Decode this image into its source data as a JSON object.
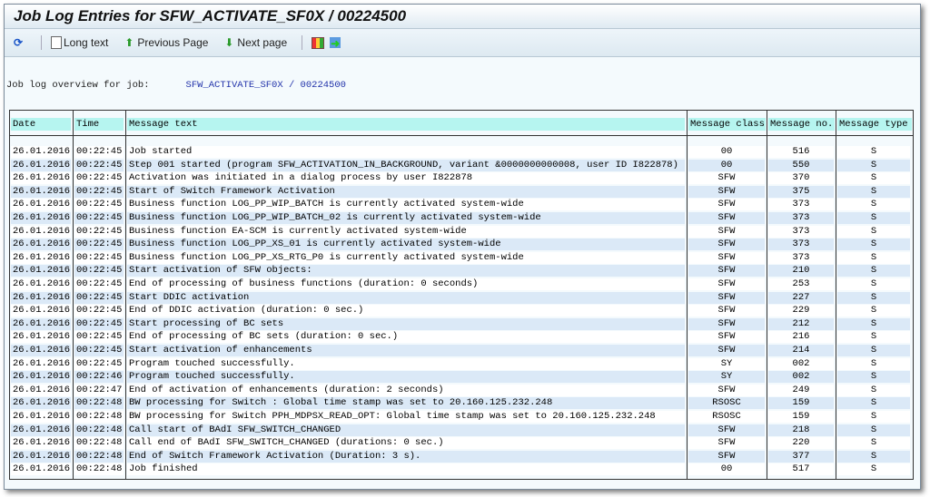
{
  "title": "Job Log Entries for SFW_ACTIVATE_SF0X / 00224500",
  "toolbar": {
    "refresh_icon": "refresh-icon",
    "long_text": "Long text",
    "previous_page": "Previous Page",
    "next_page": "Next page",
    "layout_icon": "grid-icon",
    "export_icon": "export-icon"
  },
  "overview": {
    "label": "Job log overview for job:",
    "job": "SFW_ACTIVATE_SF0X / 00224500"
  },
  "columns": [
    "Date",
    "Time",
    "Message text",
    "Message class",
    "Message no.",
    "Message type"
  ],
  "rows": [
    [
      "26.01.2016",
      "00:22:45",
      "Job started",
      "00",
      "516",
      "S"
    ],
    [
      "26.01.2016",
      "00:22:45",
      "Step 001 started (program SFW_ACTIVATION_IN_BACKGROUND, variant &0000000000008, user ID I822878)",
      "00",
      "550",
      "S"
    ],
    [
      "26.01.2016",
      "00:22:45",
      "Activation was initiated in a dialog process by user I822878",
      "SFW",
      "370",
      "S"
    ],
    [
      "26.01.2016",
      "00:22:45",
      "Start of Switch Framework Activation",
      "SFW",
      "375",
      "S"
    ],
    [
      "26.01.2016",
      "00:22:45",
      "Business function LOG_PP_WIP_BATCH is currently activated system-wide",
      "SFW",
      "373",
      "S"
    ],
    [
      "26.01.2016",
      "00:22:45",
      "Business function LOG_PP_WIP_BATCH_02 is currently activated system-wide",
      "SFW",
      "373",
      "S"
    ],
    [
      "26.01.2016",
      "00:22:45",
      "Business function EA-SCM is currently activated system-wide",
      "SFW",
      "373",
      "S"
    ],
    [
      "26.01.2016",
      "00:22:45",
      "Business function LOG_PP_XS_01 is currently activated system-wide",
      "SFW",
      "373",
      "S"
    ],
    [
      "26.01.2016",
      "00:22:45",
      "Business function LOG_PP_XS_RTG_P0 is currently activated system-wide",
      "SFW",
      "373",
      "S"
    ],
    [
      "26.01.2016",
      "00:22:45",
      "Start activation of SFW objects:",
      "SFW",
      "210",
      "S"
    ],
    [
      "26.01.2016",
      "00:22:45",
      "End of processing of business functions (duration: 0 seconds)",
      "SFW",
      "253",
      "S"
    ],
    [
      "26.01.2016",
      "00:22:45",
      "Start DDIC activation",
      "SFW",
      "227",
      "S"
    ],
    [
      "26.01.2016",
      "00:22:45",
      "End of DDIC activation (duration: 0 sec.)",
      "SFW",
      "229",
      "S"
    ],
    [
      "26.01.2016",
      "00:22:45",
      "Start processing of BC sets",
      "SFW",
      "212",
      "S"
    ],
    [
      "26.01.2016",
      "00:22:45",
      "End of processing of BC sets (duration: 0 sec.)",
      "SFW",
      "216",
      "S"
    ],
    [
      "26.01.2016",
      "00:22:45",
      "Start activation of enhancements",
      "SFW",
      "214",
      "S"
    ],
    [
      "26.01.2016",
      "00:22:45",
      "Program touched successfully.",
      "SY",
      "002",
      "S"
    ],
    [
      "26.01.2016",
      "00:22:46",
      "Program touched successfully.",
      "SY",
      "002",
      "S"
    ],
    [
      "26.01.2016",
      "00:22:47",
      "End of activation of enhancements (duration: 2 seconds)",
      "SFW",
      "249",
      "S"
    ],
    [
      "26.01.2016",
      "00:22:48",
      "BW processing for Switch : Global time stamp was set to 20.160.125.232.248",
      "RSOSC",
      "159",
      "S"
    ],
    [
      "26.01.2016",
      "00:22:48",
      "BW processing for Switch PPH_MDPSX_READ_OPT: Global time stamp was set to 20.160.125.232.248",
      "RSOSC",
      "159",
      "S"
    ],
    [
      "26.01.2016",
      "00:22:48",
      "Call start of BAdI SFW_SWITCH_CHANGED",
      "SFW",
      "218",
      "S"
    ],
    [
      "26.01.2016",
      "00:22:48",
      "Call end of BAdI SFW_SWITCH_CHANGED (durations: 0 sec.)",
      "SFW",
      "220",
      "S"
    ],
    [
      "26.01.2016",
      "00:22:48",
      "End of Switch Framework Activation (Duration: 3 s).",
      "SFW",
      "377",
      "S"
    ],
    [
      "26.01.2016",
      "00:22:48",
      "Job finished",
      "00",
      "517",
      "S"
    ]
  ]
}
